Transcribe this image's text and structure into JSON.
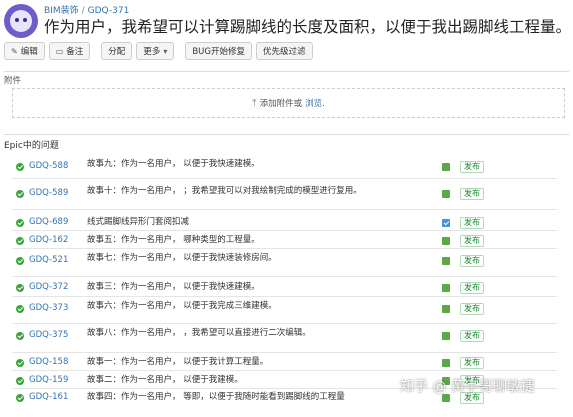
{
  "header": {
    "project": "BIM装饰",
    "issue_key": "GDQ-371",
    "title": "作为用户，我希望可以计算踢脚线的长度及面积，以便于我出踢脚线工程量。"
  },
  "toolbar": {
    "edit": "编辑",
    "comment": "备注",
    "assign": "分配",
    "more": "更多",
    "bug_start": "BUG开始修复",
    "priority_filter": "优先级过滤"
  },
  "attachments": {
    "label": "附件",
    "add_text": "添加附件或",
    "browse": "浏览."
  },
  "epic": {
    "label": "Epic中的问题",
    "rows": [
      {
        "key": "GDQ-588",
        "summary": "故事九：作为一名用户，                                    以便于我快速建模。",
        "type": "story",
        "status": "发布"
      },
      {
        "key": "GDQ-589",
        "summary": "故事十：作为一名用户，                                                  ；我希望我可以对我绘制完成的模型进行复用。",
        "type": "story",
        "status": "发布"
      },
      {
        "key": "GDQ-689",
        "summary": "线式踢脚线异形门套阅扣减",
        "type": "task",
        "status": "发布"
      },
      {
        "key": "GDQ-162",
        "summary": "故事五：作为一名用户，                                    哪种类型的工程量。",
        "type": "story",
        "status": "发布"
      },
      {
        "key": "GDQ-521",
        "summary": "故事七：作为一名用户，                                         以便于我快速装修房间。",
        "type": "story",
        "status": "发布"
      },
      {
        "key": "GDQ-372",
        "summary": "故事三：作为一名用户，                                   以便于我快速建模。",
        "type": "story",
        "status": "发布"
      },
      {
        "key": "GDQ-373",
        "summary": "故事六：作为一名用户，                                                  以便于我完成三维建模。",
        "type": "story",
        "status": "发布"
      },
      {
        "key": "GDQ-375",
        "summary": "故事八：作为一名用户，                                            ，我希望可以直接进行二次编辑。",
        "type": "story",
        "status": "发布"
      },
      {
        "key": "GDQ-158",
        "summary": "故事一：作为一名用户，                                      以便于我计算工程量。",
        "type": "story",
        "status": "发布"
      },
      {
        "key": "GDQ-159",
        "summary": "故事二：作为一名用户，                                   以便于我建模。",
        "type": "story",
        "status": "发布"
      },
      {
        "key": "GDQ-161",
        "summary": "故事四：作为一名用户，                                        等即，以便于我随时能看到踢脚线的工程量",
        "type": "story",
        "status": "发布"
      }
    ]
  },
  "watermark": "知乎 @ 黄宇哥聊敏捷"
}
